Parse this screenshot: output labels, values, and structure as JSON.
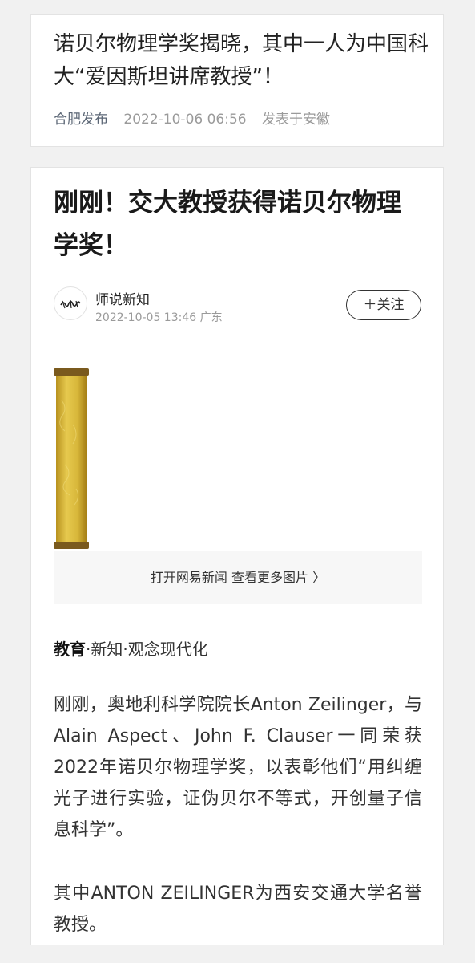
{
  "card1": {
    "title": "诺贝尔物理学奖揭晓，其中一人为中国科大“爱因斯坦讲席教授”！",
    "source": "合肥发布",
    "time": "2022-10-06 06:56",
    "location": "发表于安徽"
  },
  "article": {
    "title": "刚刚！交大教授获得诺贝尔物理学奖！",
    "author": "师说新知",
    "post_time": "2022-10-05 13:46 广东",
    "follow_label": "＋关注",
    "open_more": "打开网易新闻 查看更多图片 〉",
    "tagline_bold": "教育",
    "tagline_rest": "·新知·观念现代化",
    "paragraphs": [
      "刚刚，奥地利科学院院长Anton Zeilinger，与Alain Aspect、John F. Clauser一同荣获2022年诺贝尔物理学奖，以表彰他们“用纠缠光子进行实验，证伪贝尔不等式，开创量子信息科学”。",
      "其中ANTON ZEILINGER为西安交通大学名誉教授。"
    ]
  },
  "colors": {
    "background": "#f1f1f1",
    "card": "#ffffff",
    "meta": "#9a9a9a",
    "scroll_gold": "#d8b73a"
  }
}
